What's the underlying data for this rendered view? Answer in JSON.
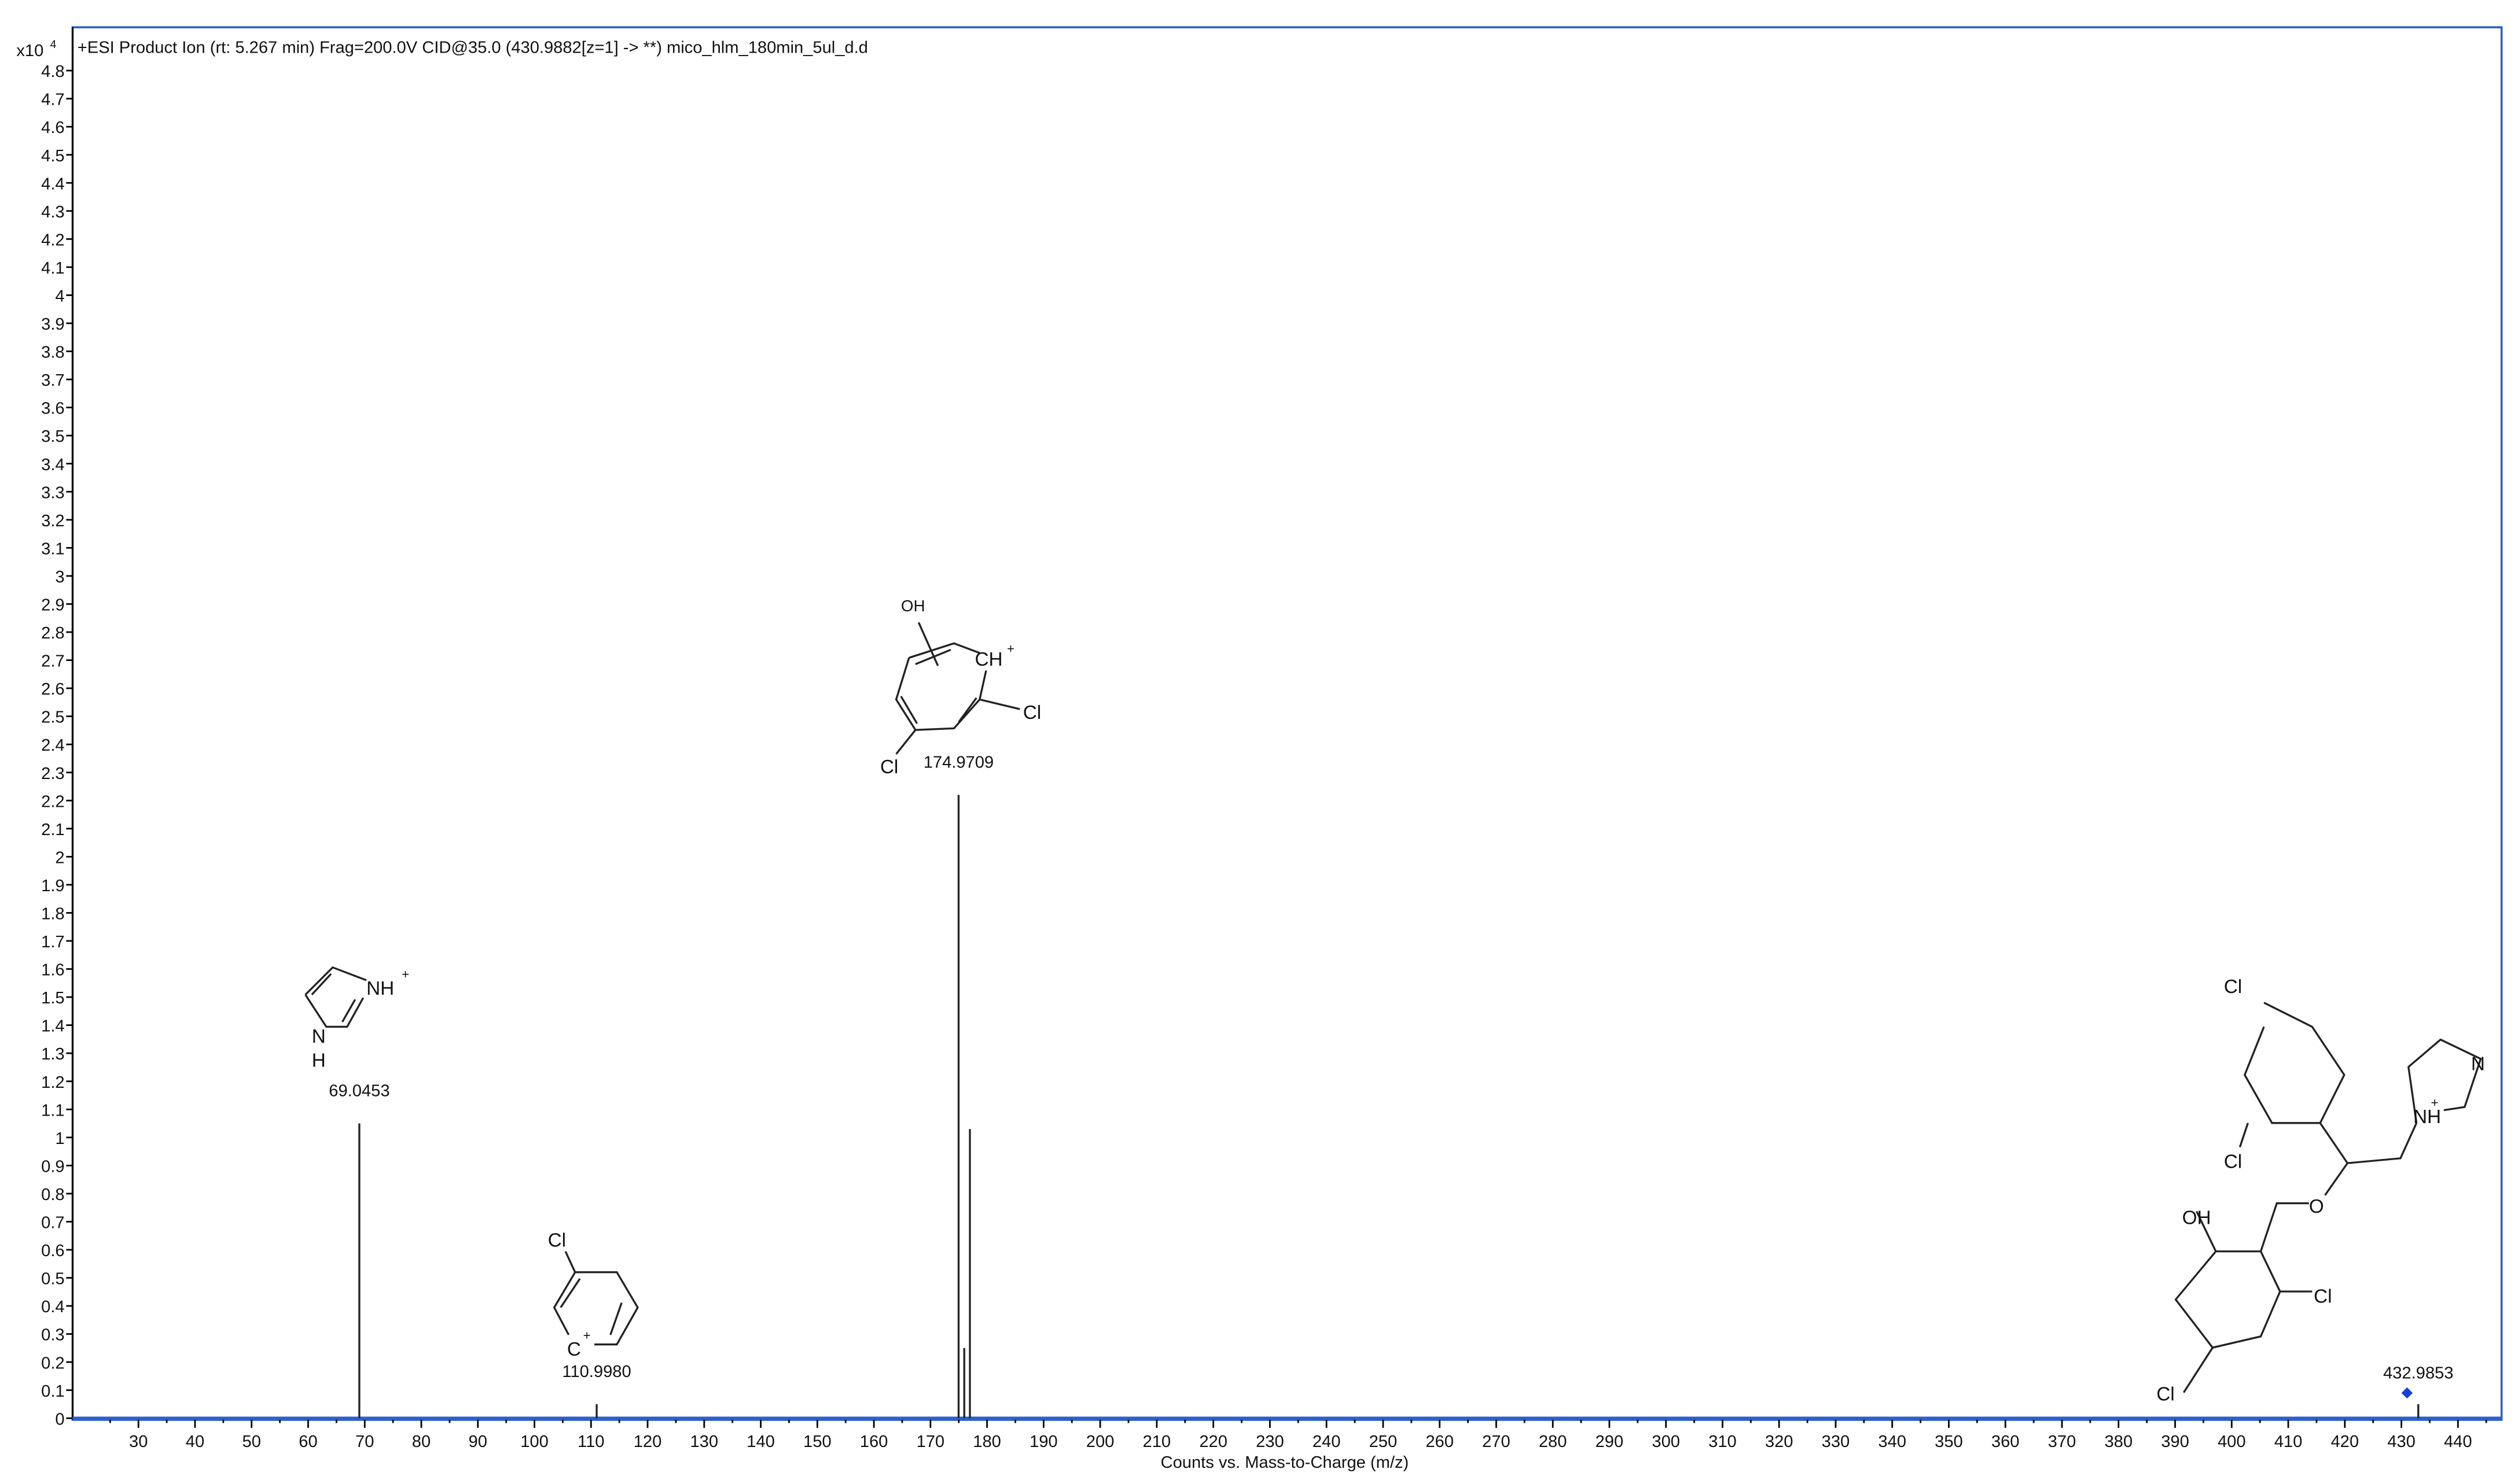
{
  "chart_data": {
    "type": "bar",
    "title": "+ESI Product Ion (rt: 5.267 min) Frag=200.0V CID@35.0 (430.9882[z=1] -> **) mico_hlm_180min_5ul_d.d",
    "xlabel": "Counts vs. Mass-to-Charge (m/z)",
    "ylabel_multiplier": "x10",
    "ylabel_exponent": "4",
    "xlim": [
      26,
      444
    ],
    "ylim": [
      0,
      4.8
    ],
    "x_ticks": [
      30,
      40,
      50,
      60,
      70,
      80,
      90,
      100,
      110,
      120,
      130,
      140,
      150,
      160,
      170,
      180,
      190,
      200,
      210,
      220,
      230,
      240,
      250,
      260,
      270,
      280,
      290,
      300,
      310,
      320,
      330,
      340,
      350,
      360,
      370,
      380,
      390,
      400,
      410,
      420,
      430,
      440
    ],
    "y_ticks": [
      "0",
      "0.1",
      "0.2",
      "0.3",
      "0.4",
      "0.5",
      "0.6",
      "0.7",
      "0.8",
      "0.9",
      "1",
      "1.1",
      "1.2",
      "1.3",
      "1.4",
      "1.5",
      "1.6",
      "1.7",
      "1.8",
      "1.9",
      "2",
      "2.1",
      "2.2",
      "2.3",
      "2.4",
      "2.5",
      "2.6",
      "2.7",
      "2.8",
      "2.9",
      "3",
      "3.1",
      "3.2",
      "3.3",
      "3.4",
      "3.5",
      "3.6",
      "3.7",
      "3.8",
      "3.9",
      "4",
      "4.1",
      "4.2",
      "4.3",
      "4.4",
      "4.5",
      "4.6",
      "4.7",
      "4.8"
    ],
    "peaks": [
      {
        "mz": 69.0453,
        "value": 1.05,
        "label": "69.0453"
      },
      {
        "mz": 110.998,
        "value": 0.05,
        "label": "110.9980"
      },
      {
        "mz": 174.9709,
        "value": 2.22,
        "label": "174.9709"
      },
      {
        "mz": 175.97,
        "value": 0.25,
        "label": ""
      },
      {
        "mz": 176.97,
        "value": 1.03,
        "label": ""
      },
      {
        "mz": 432.9853,
        "value": 0.05,
        "label": "432.9853"
      }
    ],
    "precursor_marker": {
      "mz": 432.9853,
      "value": 0.09,
      "color": "#1a3fd6"
    },
    "colors": {
      "frame": "#2a62c9",
      "peak": "#222222"
    }
  },
  "structures": {
    "imidazolium": {
      "nh_plus": "NH",
      "plus": "+",
      "n": "N",
      "h": "H"
    },
    "chlorophenyl": {
      "cl": "Cl",
      "c_plus": "C",
      "plus": "+"
    },
    "tropylium": {
      "oh": "OH",
      "ch_plus": "CH",
      "plus": "+",
      "cl1": "Cl",
      "cl2": "Cl"
    },
    "parent": {
      "cl1": "Cl",
      "cl2": "Cl",
      "nh_plus": "NH",
      "plus": "+",
      "n": "N",
      "o": "O",
      "oh": "OH",
      "cl3": "Cl",
      "cl4": "Cl"
    }
  }
}
